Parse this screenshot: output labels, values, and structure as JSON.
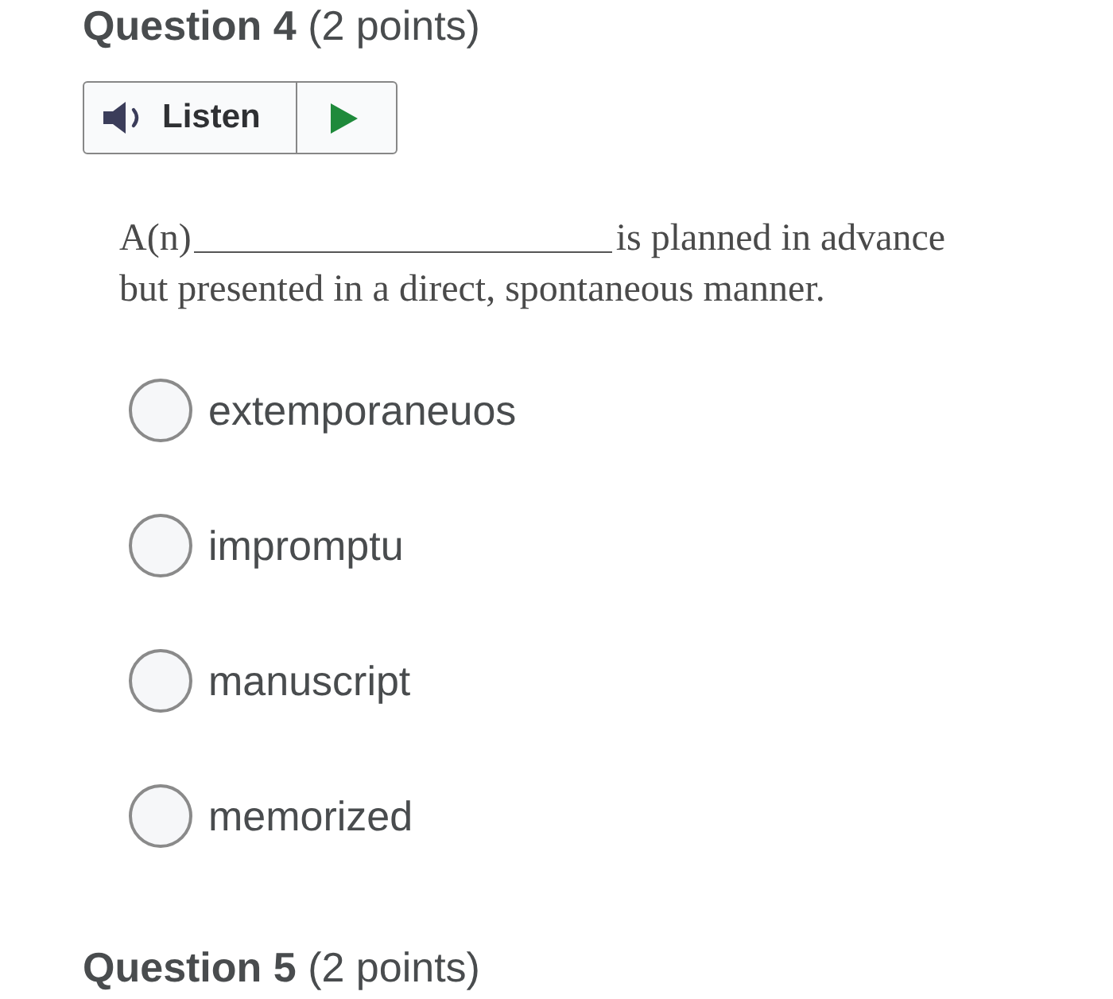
{
  "question": {
    "title": "**Question 4** (2 points)",
    "audio": {
      "label": "Listen"
    },
    "prompt": {
      "before": "A(n)",
      "after": "is planned in advance",
      "continuation": "but presented in a direct, spontaneous manner."
    },
    "options": [
      {
        "label": "extemporaneuos",
        "selected": false
      },
      {
        "label": "impromptu",
        "selected": false
      },
      {
        "label": "manuscript",
        "selected": false
      },
      {
        "label": "memorized",
        "selected": false
      }
    ]
  },
  "next_question": {
    "title": "**Question 5** (2 points)"
  }
}
